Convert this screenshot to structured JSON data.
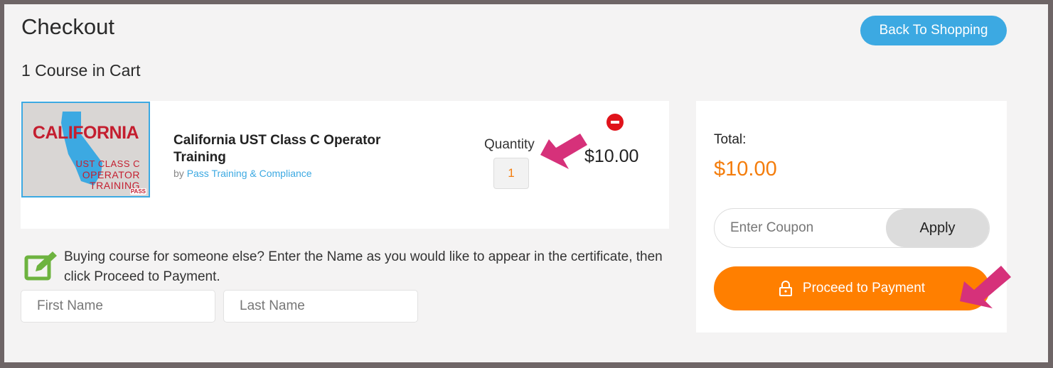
{
  "header": {
    "title": "Checkout",
    "back_label": "Back To Shopping",
    "cart_count": "1 Course in Cart"
  },
  "cart_item": {
    "thumbnail": {
      "line1": "CALIFORNIA",
      "line2": "UST CLASS C",
      "line3": "OPERATOR",
      "line4": "TRAINING",
      "logo": "PASS"
    },
    "name": "California UST Class C Operator Training",
    "by_prefix": "by",
    "provider": "Pass Training & Compliance",
    "quantity_label": "Quantity",
    "quantity": "1",
    "price": "$10.00"
  },
  "gift_note": {
    "text": "Buying course for someone else? Enter the Name as you would like to appear in the certificate, then click Proceed to Payment.",
    "first_name_placeholder": "First Name",
    "last_name_placeholder": "Last Name"
  },
  "summary": {
    "total_label": "Total:",
    "total_value": "$10.00",
    "coupon_placeholder": "Enter Coupon",
    "apply_label": "Apply",
    "pay_label": "Proceed to Payment"
  },
  "icons": {
    "remove": "remove-icon",
    "edit": "edit-icon",
    "lock": "lock-icon",
    "annotation_arrow": "arrow-icon"
  },
  "colors": {
    "accent_blue": "#3ca9e2",
    "accent_orange": "#ff7f00",
    "price_orange": "#f47d0c",
    "annotation_pink": "#d6317a",
    "remove_red": "#e0131b",
    "edit_green": "#6db33f"
  }
}
